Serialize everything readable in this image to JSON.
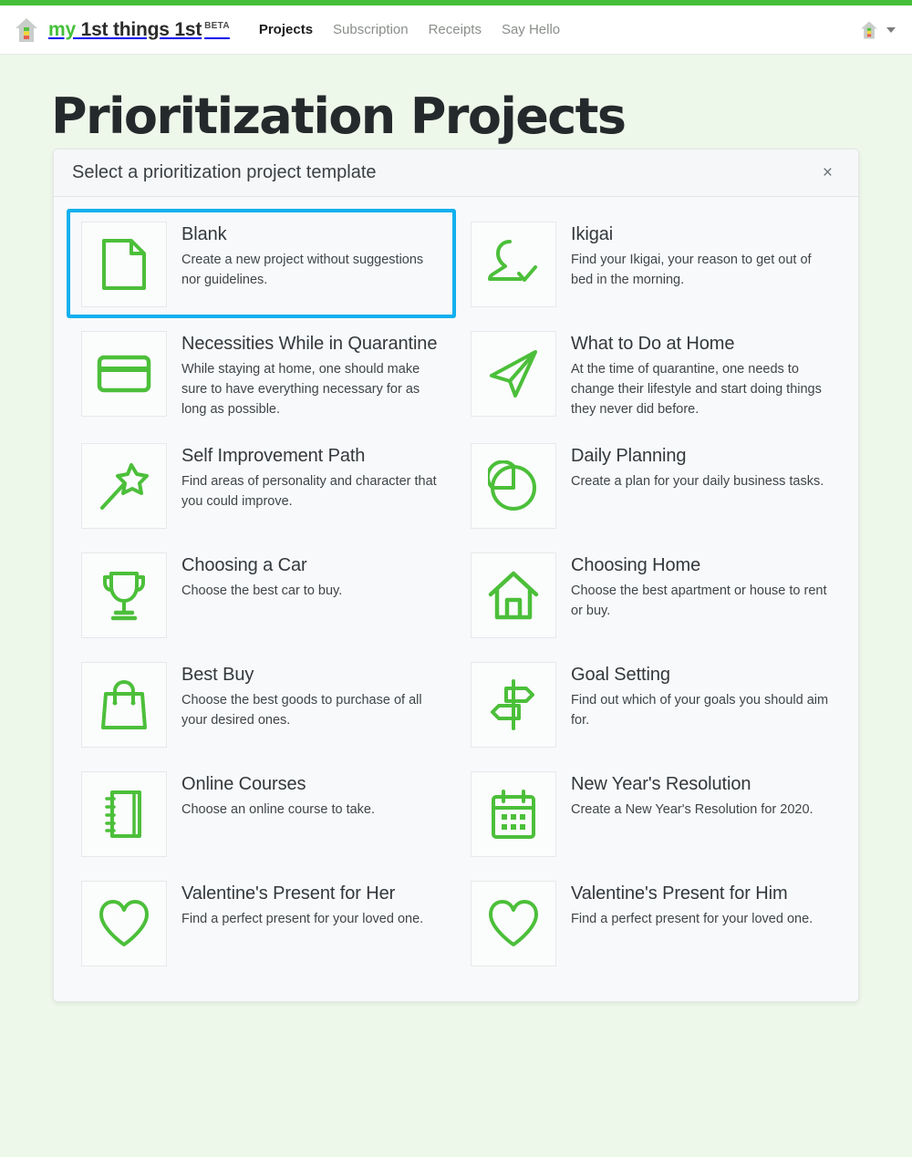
{
  "theme": {
    "accent_green": "#45bf39",
    "selection_blue": "#0fb0ee",
    "page_background": "#edf7ea",
    "card_background": "#f8f9fa"
  },
  "navbar": {
    "logo_icon": "house-logo-icon",
    "brand_prefix": "my",
    "brand_rest": " 1st things 1st",
    "brand_badge": "BETA",
    "links": [
      {
        "label": "Projects",
        "active": true
      },
      {
        "label": "Subscription",
        "active": false
      },
      {
        "label": "Receipts",
        "active": false
      },
      {
        "label": "Say Hello",
        "active": false
      }
    ],
    "account_icon": "house-avatar-icon",
    "account_caret_icon": "chevron-down-icon"
  },
  "page": {
    "title": "Prioritization Projects"
  },
  "modal": {
    "title": "Select a prioritization project template",
    "close_label": "×",
    "templates": [
      {
        "title": "Blank",
        "description": "Create a new project without suggestions nor guidelines.",
        "icon": "document-icon",
        "selected": true
      },
      {
        "title": "Ikigai",
        "description": "Find your Ikigai, your reason to get out of bed in the morning.",
        "icon": "person-check-icon",
        "selected": false
      },
      {
        "title": "Necessities While in Quarantine",
        "description": "While staying at home, one should make sure to have everything necessary for as long as possible.",
        "icon": "credit-card-icon",
        "selected": false
      },
      {
        "title": "What to Do at Home",
        "description": "At the time of quarantine, one needs to change their lifestyle and start doing things they never did before.",
        "icon": "paper-plane-icon",
        "selected": false
      },
      {
        "title": "Self Improvement Path",
        "description": "Find areas of personality and character that you could improve.",
        "icon": "magic-wand-icon",
        "selected": false
      },
      {
        "title": "Daily Planning",
        "description": "Create a plan for your daily business tasks.",
        "icon": "pie-chart-icon",
        "selected": false
      },
      {
        "title": "Choosing a Car",
        "description": "Choose the best car to buy.",
        "icon": "trophy-icon",
        "selected": false
      },
      {
        "title": "Choosing Home",
        "description": "Choose the best apartment or house to rent or buy.",
        "icon": "home-icon",
        "selected": false
      },
      {
        "title": "Best Buy",
        "description": "Choose the best goods to purchase of all your desired ones.",
        "icon": "shopping-bag-icon",
        "selected": false
      },
      {
        "title": "Goal Setting",
        "description": "Find out which of your goals you should aim for.",
        "icon": "signpost-icon",
        "selected": false
      },
      {
        "title": "Online Courses",
        "description": "Choose an online course to take.",
        "icon": "notebook-icon",
        "selected": false
      },
      {
        "title": "New Year's Resolution",
        "description": "Create a New Year's Resolution for 2020.",
        "icon": "calendar-icon",
        "selected": false
      },
      {
        "title": "Valentine's Present for Her",
        "description": "Find a perfect present for your loved one.",
        "icon": "heart-icon",
        "selected": false
      },
      {
        "title": "Valentine's Present for Him",
        "description": "Find a perfect present for your loved one.",
        "icon": "heart-icon",
        "selected": false
      }
    ]
  }
}
